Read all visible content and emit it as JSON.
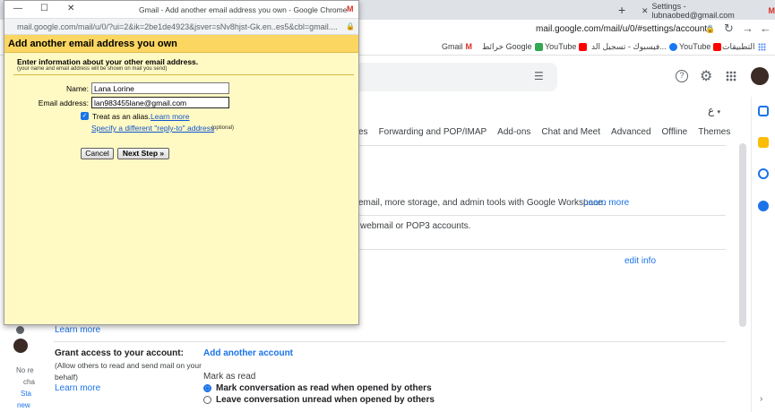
{
  "browser": {
    "bg_tab_title": "Settings - lubnaobed@gmail.com",
    "url": "mail.google.com/mail/u/0/#settings/accounts",
    "bookmarks": [
      {
        "label": "Gmail"
      },
      {
        "label": "خرائط Google"
      },
      {
        "label": "YouTube"
      },
      {
        "label": "فيسبوك - تسجيل الد..."
      },
      {
        "label": "YouTube"
      },
      {
        "label": "التطبيقات"
      }
    ]
  },
  "gmail": {
    "lang_indicator": "ع",
    "tabs": [
      "es",
      "Forwarding and POP/IMAP",
      "Add-ons",
      "Chat and Meet",
      "Advanced",
      "Offline",
      "Themes"
    ],
    "workspace_text": "email, more storage, and admin tools with Google Workspace.",
    "workspace_link": "Learn more",
    "pop3_text": "webmail or POP3 accounts.",
    "edit_info": "edit info",
    "learn_more_1": "Learn more",
    "grant_title": "Grant access to your account:",
    "grant_desc_1": "(Allow others to read and send mail on your",
    "grant_desc_2": "behalf)",
    "learn_more_2": "Learn more",
    "add_another_account": "Add another account",
    "mark_as_read_title": "Mark as read",
    "mark_read_option": "Mark conversation as read when opened by others",
    "leave_unread_option": "Leave conversation unread when opened by others",
    "left_frags": [
      "No re",
      "cha",
      "Sta",
      "new"
    ]
  },
  "popup": {
    "window_title": "Gmail - Add another email address you own - Google Chrome",
    "url": "mail.google.com/mail/u/0/?ui=2&ik=2be1de4923&jsver=sNv8hjst-Gk.en..es5&cbl=gmail....",
    "header": "Add another email address you own",
    "intro_title": "Enter information about your other email address.",
    "intro_sub": "(your name and email address will be shown on mail you send)",
    "name_label": "Name:",
    "name_value": "Lana Lorine",
    "email_label": "Email address:",
    "email_value": "lan983455lane@gmail.com",
    "alias_label": "Treat as an alias.",
    "alias_learn_more": "Learn more",
    "alias_checked": true,
    "replyto_link": "Specify a different \"reply-to\" address",
    "optional": "(optional)",
    "cancel_label": "Cancel",
    "next_label": "Next Step »"
  },
  "colors": {
    "popup_bg": "#fff9c4",
    "popup_header": "#fbd661",
    "link": "#1155cc",
    "gmail_link": "#1a73e8"
  }
}
